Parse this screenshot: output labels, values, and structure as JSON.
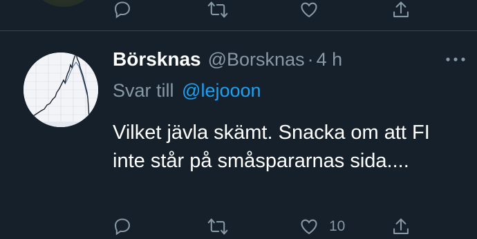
{
  "prev_tweet": {
    "actions": {
      "reply_icon": "comment-icon",
      "retweet_icon": "retweet-icon",
      "like_icon": "heart-icon",
      "share_icon": "share-icon"
    }
  },
  "tweet": {
    "display_name": "Börsknas",
    "handle": "@Borsknas",
    "separator": "·",
    "time": "4 h",
    "reply_prefix": "Svar till",
    "reply_mention": "@lejooon",
    "text": "Vilket jävla skämt. Snacka om att FI inte står på småspararnas sida....",
    "like_count": "10",
    "actions": {
      "reply_icon": "comment-icon",
      "retweet_icon": "retweet-icon",
      "like_icon": "heart-icon",
      "share_icon": "share-icon",
      "more_icon": "more-icon"
    }
  },
  "colors": {
    "background": "#15202b",
    "divider": "#38444d",
    "secondary_text": "#8899a6",
    "primary_text": "#ffffff",
    "link": "#1da1f2"
  }
}
